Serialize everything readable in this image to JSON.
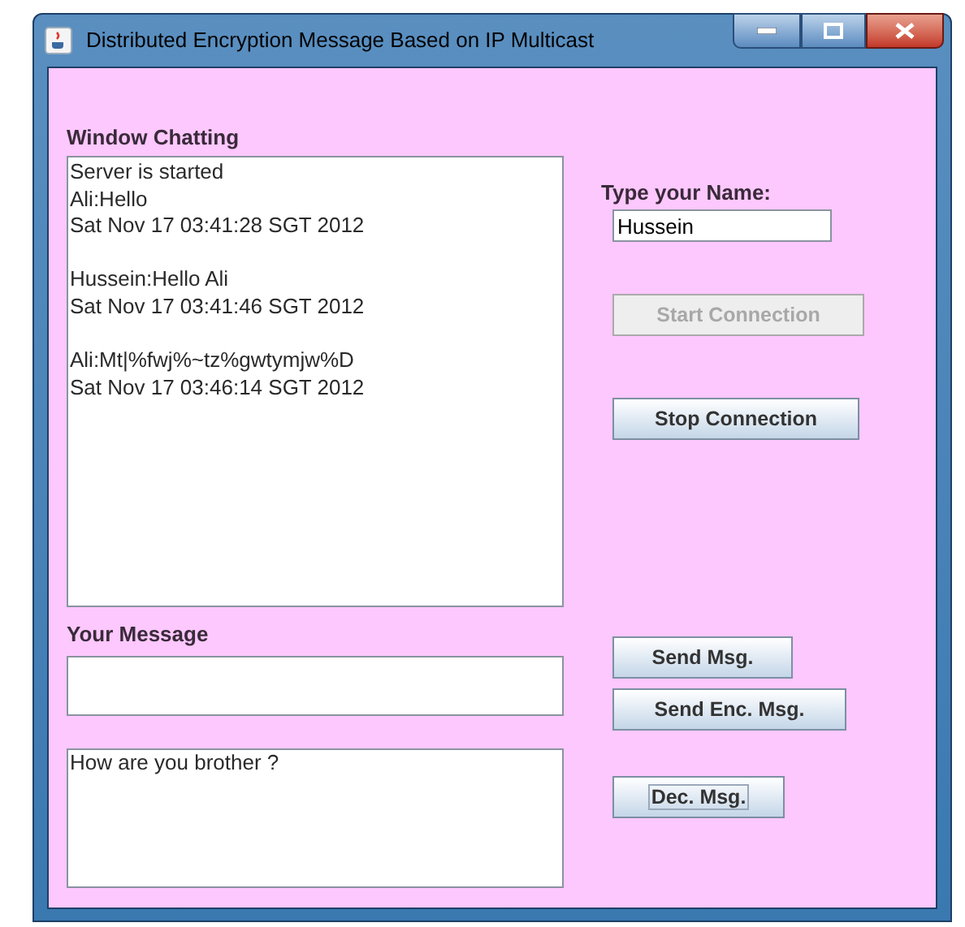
{
  "window": {
    "title": "Distributed Encryption Message Based on IP Multicast"
  },
  "chat": {
    "label": "Window Chatting",
    "entries": [
      {
        "lines": [
          "Server is started",
          "Ali:Hello",
          "Sat Nov 17 03:41:28 SGT 2012"
        ]
      },
      {
        "lines": [
          "Hussein:Hello Ali",
          "Sat Nov 17 03:41:46 SGT 2012"
        ]
      },
      {
        "lines": [
          "Ali:Mt|%fwj%~tz%gwtymjw%D",
          "Sat Nov 17 03:46:14 SGT 2012"
        ]
      }
    ]
  },
  "name_label": "Type your Name:",
  "name_field": {
    "value": "Hussein"
  },
  "connection_buttons": [
    {
      "label": "Start Connection",
      "disabled": true
    },
    {
      "label": "Stop Connection",
      "disabled": false
    }
  ],
  "message_label": "Your Message",
  "send_buttons": [
    {
      "label": "Send Msg.",
      "focused": false
    },
    {
      "label": "Send Enc. Msg.",
      "focused": false
    }
  ],
  "output_box": {
    "value": "How are you brother ?"
  },
  "decrypt_button": {
    "label": "Dec. Msg.",
    "focused": true
  }
}
